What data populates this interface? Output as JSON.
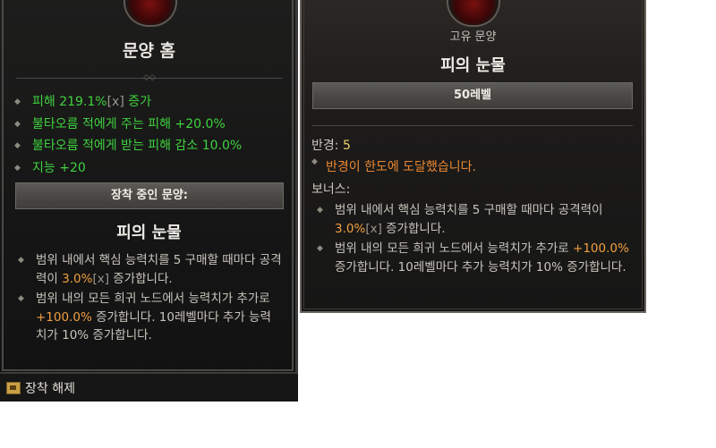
{
  "left": {
    "title": "문양 홈",
    "stats": [
      {
        "pre": "피해 219.1%",
        "bracket": "[x]",
        "post": " 증가"
      },
      {
        "pre": "불타오름 적에게 주는 피해 +20.0%",
        "bracket": "",
        "post": ""
      },
      {
        "pre": "불타오름 적에게 받는 피해 감소 10.0%",
        "bracket": "",
        "post": ""
      },
      {
        "pre": "지능 +20",
        "bracket": "",
        "post": ""
      }
    ],
    "equipped_label": "장착 중인 문양:",
    "glyph_name": "피의 눈물",
    "desc1": {
      "a": "범위 내에서 핵심 능력치를 5 구매할 때마다 공격력이 ",
      "val": "3.0%",
      "bracket": "[x]",
      "b": " 증가합니다."
    },
    "desc2": {
      "a": "범위 내의 모든 희귀 노드에서 능력치가 추가로 ",
      "val": "+100.0%",
      "b": " 증가합니다. 10레벨마다 추가 능력치가 10% 증가합니다."
    },
    "unequip_label": "장착 해제"
  },
  "right": {
    "type": "고유 문양",
    "glyph_name": "피의 눈물",
    "level_label": "50레벨",
    "radius_label": "반경: ",
    "radius_value": "5",
    "limit_message": "반경이 한도에 도달했습니다.",
    "bonus_label": "보너스:",
    "desc1": {
      "a": "범위 내에서 핵심 능력치를 5 구매할 때마다 공격력이 ",
      "val": "3.0%",
      "bracket": "[x]",
      "b": " 증가합니다."
    },
    "desc2": {
      "a": "범위 내의 모든 희귀 노드에서 능력치가 추가로 ",
      "val": "+100.0%",
      "b": " 증가합니다. 10레벨마다 추가 능력치가 10% 증가합니다."
    }
  },
  "icons": {
    "bullet": "diamond-bullet-icon",
    "emblem": "glyph-emblem-icon",
    "unequip": "unequip-icon"
  },
  "colors": {
    "stat_green": "#3fd23f",
    "highlight_orange": "#f0a040",
    "limit_orange": "#ec8830",
    "radius_yellow": "#ecd56a"
  }
}
